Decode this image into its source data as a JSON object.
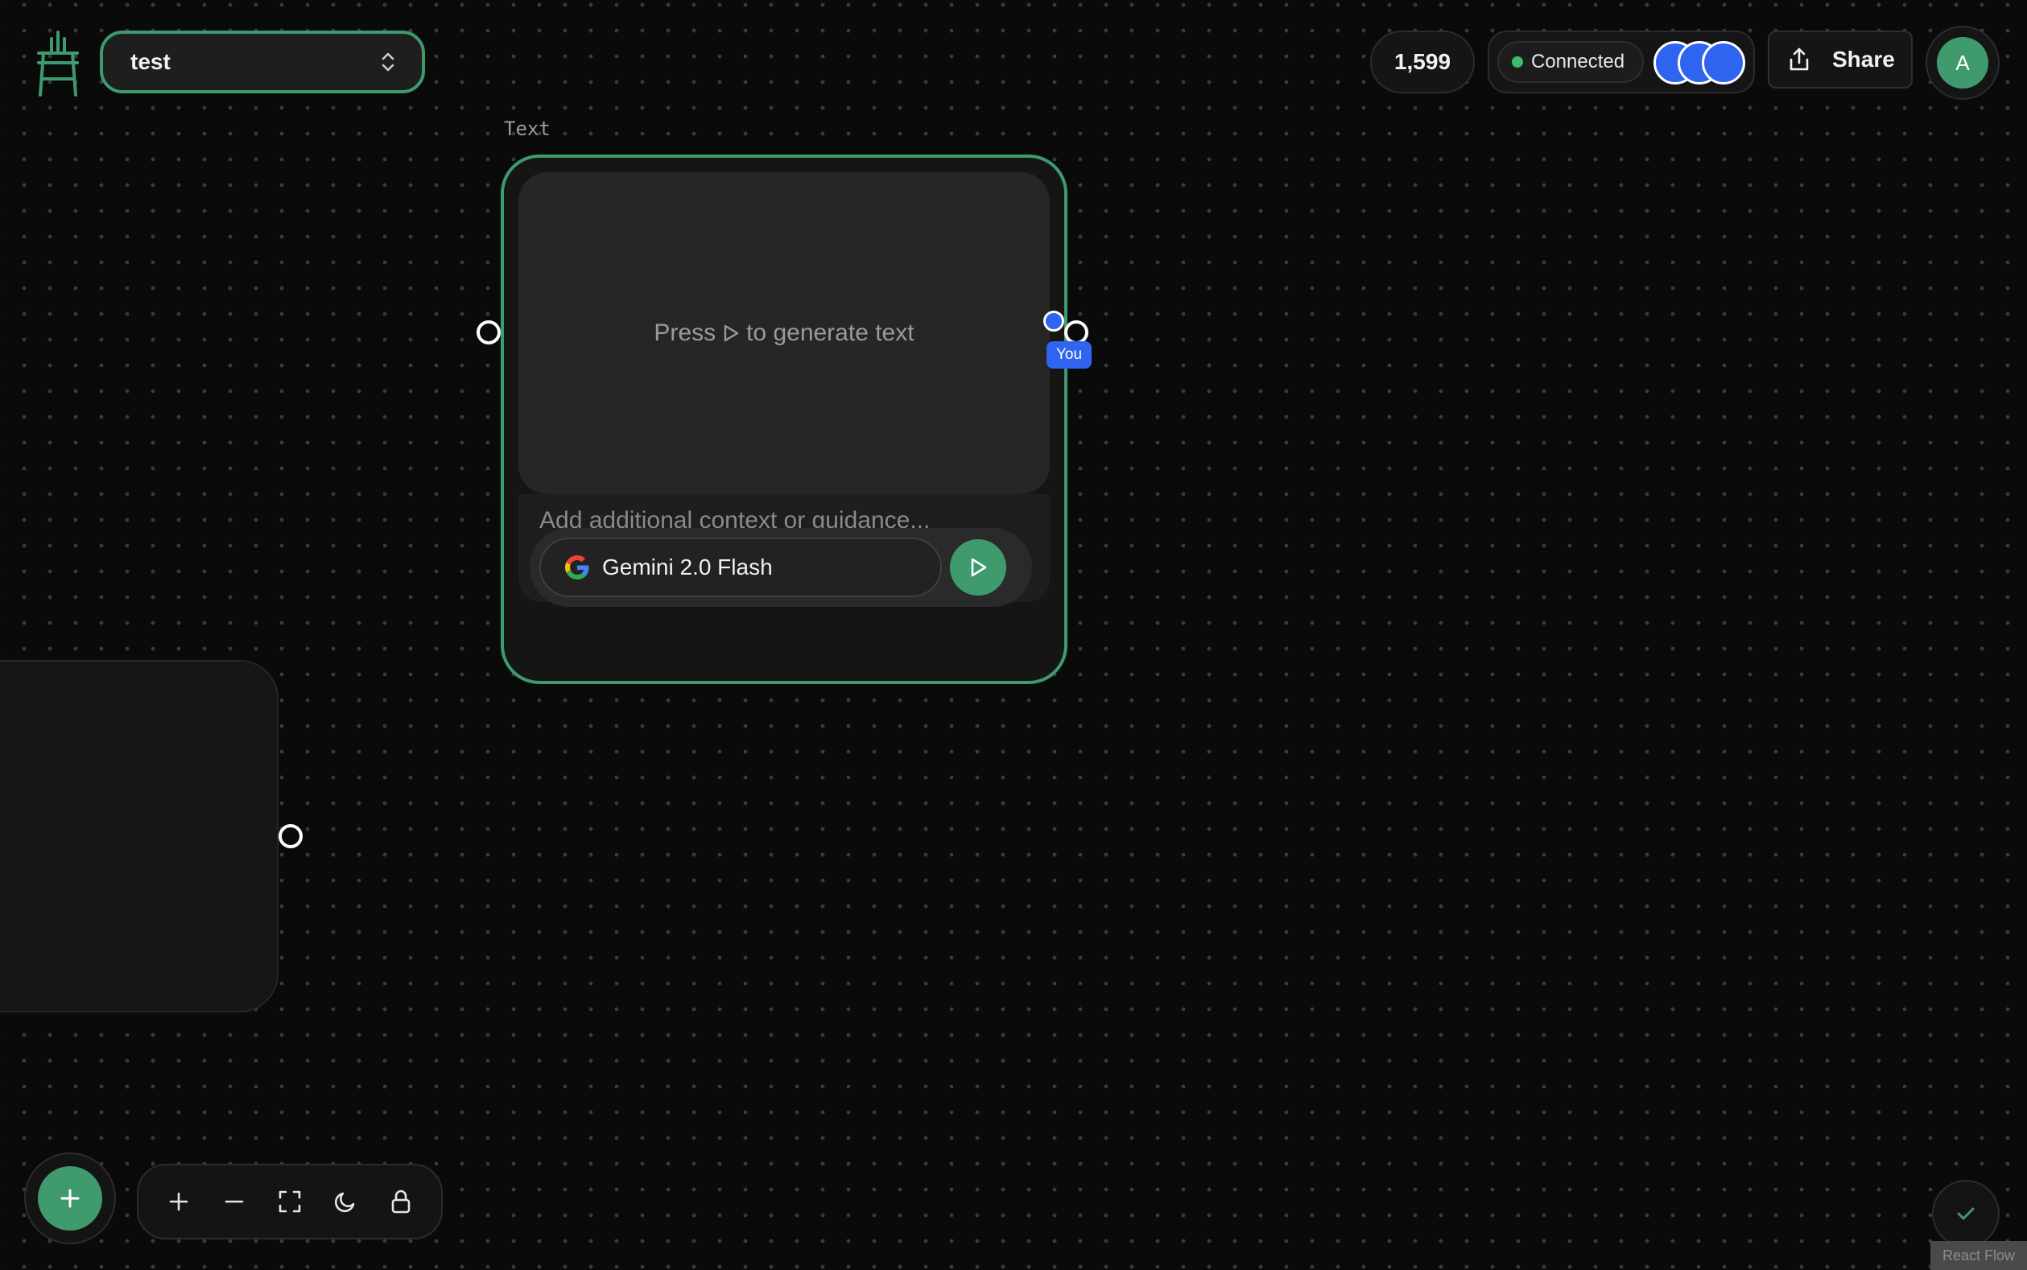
{
  "app": {
    "project_name": "test",
    "credits": "1,599",
    "status": "Connected",
    "share_label": "Share",
    "user_initial": "A",
    "attribution": "React Flow"
  },
  "node": {
    "title": "Text",
    "output_prefix": "Press",
    "output_suffix": "to generate text",
    "prompt_placeholder": "Add additional context or guidance...",
    "model_name": "Gemini 2.0 Flash",
    "model_icon": "google-icon"
  },
  "cursor": {
    "label": "You"
  },
  "colors": {
    "accent": "#3f9a6e",
    "collaborator": "#2f64f0",
    "background": "#0a0a0a"
  },
  "icons": {
    "logo": "easel-icon",
    "select": "chevron-up-down-icon",
    "share": "upload-icon",
    "run": "play-icon",
    "add": "plus-icon",
    "zoom_in": "plus-icon",
    "zoom_out": "minus-icon",
    "fit": "fullscreen-icon",
    "theme": "moon-icon",
    "lock": "lock-icon",
    "save_status": "check-icon"
  }
}
